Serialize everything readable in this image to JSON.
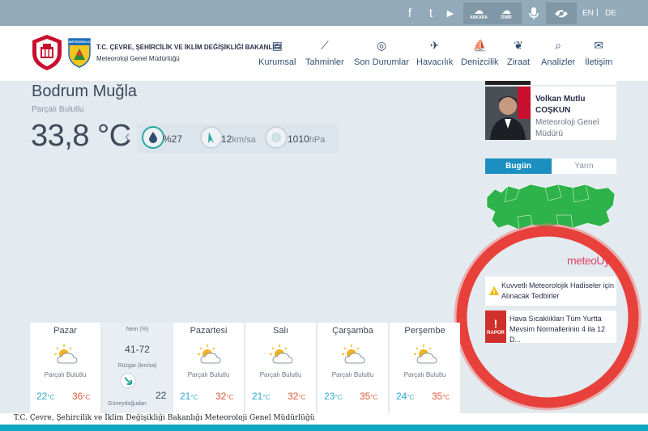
{
  "topbar": {
    "social": [
      {
        "icon": "facebook-icon",
        "glyph": "f"
      },
      {
        "icon": "twitter-icon",
        "glyph": "t"
      },
      {
        "icon": "youtube-icon",
        "glyph": "▶"
      }
    ],
    "apps": [
      {
        "icon": "ankara-app-icon",
        "glyph": "☁",
        "label": "ANKARA"
      },
      {
        "icon": "izmir-app-icon",
        "glyph": "☁",
        "label": "İZMİR"
      }
    ],
    "languages": [
      "EN",
      "DE"
    ]
  },
  "header": {
    "org_title": "T.C. ÇEVRE, ŞEHİRCİLİK VE İKLİM DEĞİŞİKLİĞİ BAKANLIĞI",
    "org_subtitle": "Meteoroloji Genel Müdürlüğü",
    "logo_text": "METEOROLOJİ",
    "nav": [
      {
        "label": "Kurumsal",
        "icon": "document-icon",
        "glyph": "▤"
      },
      {
        "label": "Tahminler",
        "icon": "chart-icon",
        "glyph": "⟋"
      },
      {
        "label": "Son Durumlar",
        "icon": "check-circle-icon",
        "glyph": "◎"
      },
      {
        "label": "Havacılık",
        "icon": "airplane-icon",
        "glyph": "✈"
      },
      {
        "label": "Denizcilik",
        "icon": "sailboat-icon",
        "glyph": "⛵"
      },
      {
        "label": "Ziraat",
        "icon": "wheat-icon",
        "glyph": "❦"
      },
      {
        "label": "Analizler",
        "icon": "search-chart-icon",
        "glyph": "⌕"
      },
      {
        "label": "İletişim",
        "icon": "envelope-icon",
        "glyph": "✉"
      }
    ]
  },
  "current": {
    "city": "Bodrum Muğla",
    "condition": "Parçalı Bulutlu",
    "temperature": "33,8 °C",
    "humidity": "%27",
    "wind_speed": "12",
    "wind_unit": "km/sa",
    "pressure": "1010",
    "pressure_unit": "hPa"
  },
  "sidebar": {
    "person_name_line1": "Volkan Mutlu",
    "person_name_line2": "COŞKUN",
    "person_role_line1": "Meteoroloji Genel",
    "person_role_line2": "Müdürü",
    "tab_today": "Bugün",
    "tab_tomorrow": "Yarın",
    "brand": "meteoUy",
    "notice": "Kuvvetli Meteorolojik Hadiseler için Alınacak Tedbirler",
    "report_badge": "RAPOR",
    "report_text": "Hava Sıcaklıkları Tüm Yurtta Mevsim Normallerinin 4 ila 12 D..."
  },
  "forecast": {
    "unit": "°C",
    "days": [
      {
        "day": "Pazar",
        "condition": "Parçalı Bulutlu",
        "min": "22",
        "max": "36"
      },
      {
        "day": "Pazartesi",
        "condition": "Parçalı Bulutlu",
        "min": "21",
        "max": "32"
      },
      {
        "day": "Salı",
        "condition": "Parçalı Bulutlu",
        "min": "21",
        "max": "32"
      },
      {
        "day": "Çarşamba",
        "condition": "Parçalı Bulutlu",
        "min": "23",
        "max": "35"
      },
      {
        "day": "Perşembe",
        "condition": "Parçalı Bulutlu",
        "min": "24",
        "max": "35"
      }
    ],
    "detail": {
      "humidity_label": "Nem (%)",
      "humidity_value": "41-72",
      "wind_label": "Rüzgar (km/sa)",
      "wind_direction": "Güneydoğudan",
      "wind_speed": "22"
    }
  },
  "footer": {
    "text": "T.C. Çevre, Şehircilik ve İklim Değişikliği Bakanlığı Meteoroloji Genel Müdürlüğü"
  },
  "colors": {
    "accent": "#1b90c0",
    "topbar": "#92aab9",
    "min_temp": "#2fa8cf",
    "max_temp": "#e05a3a",
    "highlight_ring": "#e8322c",
    "footer_bar": "#0fa6bf"
  }
}
